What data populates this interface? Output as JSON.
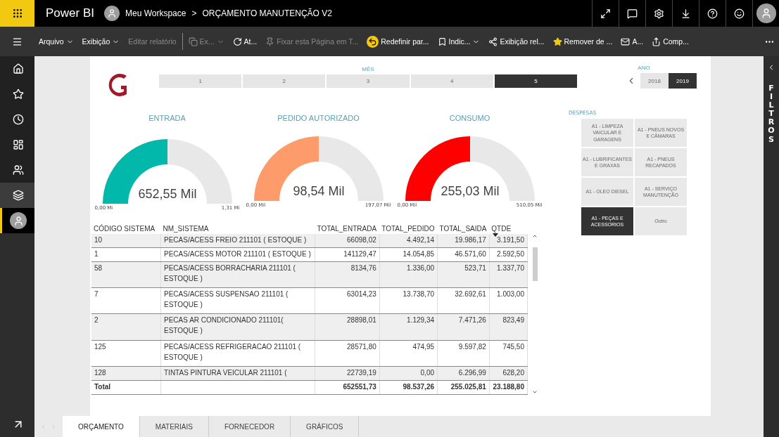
{
  "app": {
    "name": "Power BI",
    "breadcrumb_workspace": "Meu Workspace",
    "breadcrumb_separator": ">",
    "report_title": "ORÇAMENTO MANUTENÇÃO V2"
  },
  "toolbar": [
    {
      "label": "Arquivo",
      "dropdown": true,
      "disabled": false
    },
    {
      "label": "Exibição",
      "dropdown": true,
      "disabled": false
    },
    {
      "label": "Editar relatório",
      "dropdown": false,
      "disabled": true
    },
    {
      "label": "Ex...",
      "dropdown": true,
      "disabled": true
    },
    {
      "label": "At...",
      "dropdown": false,
      "disabled": false
    },
    {
      "label": "Fixar esta Página em T...",
      "dropdown": false,
      "disabled": true
    },
    {
      "label": "Redefinir par...",
      "dropdown": false,
      "disabled": false
    },
    {
      "label": "Indic...",
      "dropdown": true,
      "disabled": false
    },
    {
      "label": "Exibição rel...",
      "dropdown": false,
      "disabled": false
    },
    {
      "label": "Remover de ...",
      "dropdown": false,
      "disabled": false
    },
    {
      "label": "A...",
      "dropdown": false,
      "disabled": false
    },
    {
      "label": "Comp...",
      "dropdown": false,
      "disabled": false
    }
  ],
  "nav": [
    {
      "selected": false
    },
    {
      "selected": false
    },
    {
      "selected": false
    },
    {
      "selected": false
    },
    {
      "selected": false
    },
    {
      "selected": false
    },
    {
      "selected": true
    }
  ],
  "filters_pane": {
    "label": "FILTROS"
  },
  "month_slicer": {
    "title": "MÊS",
    "items": [
      {
        "label": "1",
        "selected": false
      },
      {
        "label": "2",
        "selected": false
      },
      {
        "label": "3",
        "selected": false
      },
      {
        "label": "4",
        "selected": false
      },
      {
        "label": "5",
        "selected": true
      }
    ]
  },
  "year_slicer": {
    "title": "ANO",
    "items": [
      {
        "label": "2018",
        "selected": false
      },
      {
        "label": "2019",
        "selected": true
      }
    ]
  },
  "gauges": [
    {
      "title": "ENTRADA",
      "value": "652,55 Mil",
      "min": "0,00 Mi",
      "max": "1,31 Mi",
      "color": "#01b8aa"
    },
    {
      "title": "PEDIDO AUTORIZADO",
      "value": "98,54 Mil",
      "min": "0,00 Mil",
      "max": "197,07 Mil",
      "color": "#fd9b6b"
    },
    {
      "title": "CONSUMO",
      "value": "255,03 Mil",
      "min": "0,00 Mil",
      "max": "510,05 Mil",
      "color": "#fe0000"
    }
  ],
  "despesas": {
    "title": "DESPESAS",
    "items": [
      {
        "label": "A1 - LIMPEZA VAICULAR E GARAGENS",
        "selected": false
      },
      {
        "label": "A1 - PNEUS NOVOS E CÂMARAS",
        "selected": false
      },
      {
        "label": "A1 - LUBRIFICANTES E GRAXAS",
        "selected": false
      },
      {
        "label": "A1 - PNEUS RECAPADOS",
        "selected": false
      },
      {
        "label": "A1 - OLEO DIESEL",
        "selected": false
      },
      {
        "label": "A1 - SERVIÇO MANUTENÇÃO",
        "selected": false
      },
      {
        "label": "A1 - PEÇAS E ACESSORIOS",
        "selected": true
      },
      {
        "label": "Outro",
        "selected": false
      }
    ]
  },
  "table": {
    "columns": [
      {
        "label": "CÓDIGO SISTEMA",
        "sorted": false
      },
      {
        "label": "NM_SISTEMA",
        "sorted": false
      },
      {
        "label": "TOTAL_ENTRADA",
        "sorted": false
      },
      {
        "label": "TOTAL_PEDIDO",
        "sorted": false
      },
      {
        "label": "TOTAL_SAIDA",
        "sorted": false
      },
      {
        "label": "QTDE",
        "sorted": true
      }
    ],
    "rows": [
      [
        "10",
        "PECAS/ACESS FREIO 211101 ( ESTOQUE )",
        "66098,02",
        "4.492,14",
        "19.986,17",
        "3.191,50"
      ],
      [
        "1",
        "PECAS/ACESS MOTOR 211101 ( ESTOQUE )",
        "141129,47",
        "14.054,85",
        "46.571,60",
        "2.592,50"
      ],
      [
        "58",
        "PECAS/ACESS BORRACHARIA 211101 ( ESTOQUE )",
        "8134,76",
        "1.336,00",
        "523,71",
        "1.337,70"
      ],
      [
        "7",
        "PECAS/ACESS SUSPENSAO 211101 ( ESTOQUE )",
        "63014,23",
        "13.738,70",
        "32.692,61",
        "1.003,00"
      ],
      [
        "2",
        "PECAS AR CONDICIONADO 211101( ESTOQUE )",
        "28898,01",
        "1.129,34",
        "7.471,26",
        "823,49"
      ],
      [
        "125",
        "PECAS/ACESS REFRIGERACAO 211101 ( ESTOQUE )",
        "28571,80",
        "474,95",
        "9.597,82",
        "745,50"
      ],
      [
        "128",
        "TINTAS PINTURA VEICULAR 211101 (",
        "22739,19",
        "0,00",
        "6.296,99",
        "628,20"
      ]
    ],
    "total": {
      "label": "Total",
      "values": [
        "652551,73",
        "98.537,26",
        "255.025,81",
        "23.188,80"
      ]
    }
  },
  "page_tabs": [
    {
      "label": "ORÇAMENTO",
      "selected": true
    },
    {
      "label": "MATERIAIS",
      "selected": false
    },
    {
      "label": "FORNECEDOR",
      "selected": false
    },
    {
      "label": "GRÁFICOS",
      "selected": false
    }
  ]
}
